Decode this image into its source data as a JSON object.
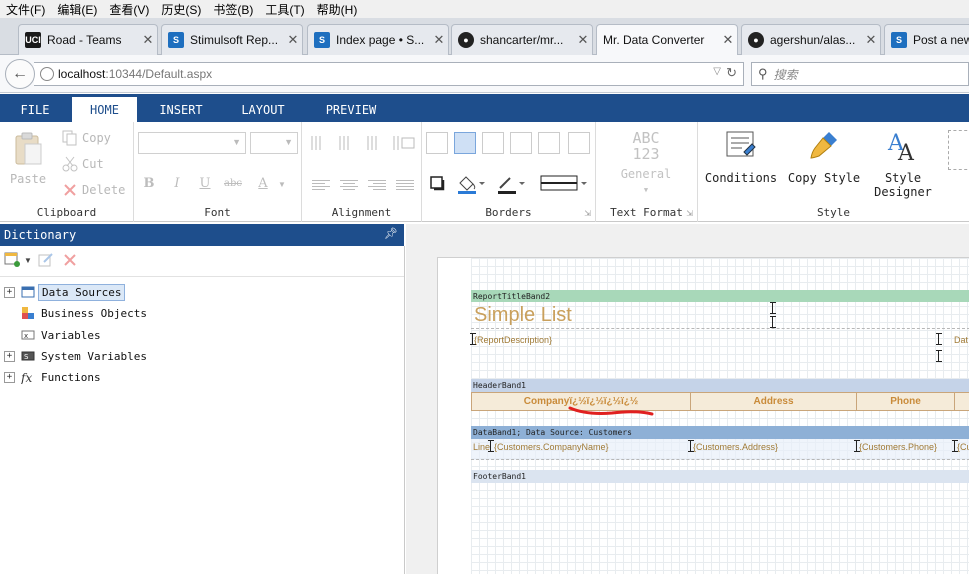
{
  "browser": {
    "menu": [
      "文件(F)",
      "编辑(E)",
      "查看(V)",
      "历史(S)",
      "书签(B)",
      "工具(T)",
      "帮助(H)"
    ],
    "tabs": [
      {
        "label": "Road - Teams",
        "icon": "teams-favicon",
        "color": "#1a1a1a",
        "glyph": "UCI"
      },
      {
        "label": "Stimulsoft Rep...",
        "icon": "stimulsoft-favicon",
        "color": "#1e6fbf",
        "glyph": "S"
      },
      {
        "label": "Index page • S...",
        "icon": "stimulsoft-favicon",
        "color": "#1e6fbf",
        "glyph": "S"
      },
      {
        "label": "shancarter/mr...",
        "icon": "github-favicon",
        "color": "#222222",
        "glyph": "●"
      },
      {
        "label": "Mr. Data Converter",
        "icon": "page-favicon",
        "color": "#ffffff",
        "glyph": ""
      },
      {
        "label": "agershun/alas...",
        "icon": "github-favicon",
        "color": "#222222",
        "glyph": "●"
      },
      {
        "label": "Post a new",
        "icon": "stimulsoft-favicon",
        "color": "#1e6fbf",
        "glyph": "S"
      }
    ],
    "url_host": "localhost",
    "url_path": ":10344/Default.aspx",
    "search_placeholder": "搜索"
  },
  "ribbon": {
    "tabs": [
      "FILE",
      "HOME",
      "INSERT",
      "LAYOUT",
      "PREVIEW"
    ],
    "active_tab": "HOME",
    "clipboard": {
      "title": "Clipboard",
      "paste": "Paste",
      "copy": "Copy",
      "cut": "Cut",
      "delete": "Delete"
    },
    "font": {
      "title": "Font",
      "bold": "B",
      "italic": "I",
      "underline": "U",
      "strike": "abc",
      "color": "A"
    },
    "alignment": {
      "title": "Alignment"
    },
    "borders": {
      "title": "Borders"
    },
    "text_format": {
      "title": "Text Format",
      "abc": "ABC",
      "num": "123",
      "general": "General"
    },
    "style": {
      "title": "Style",
      "conditions": "Conditions",
      "copy_style": "Copy Style",
      "style_designer_1": "Style",
      "style_designer_2": "Designer"
    }
  },
  "dictionary": {
    "title": "Dictionary",
    "items": [
      {
        "label": "Data Sources",
        "expandable": true,
        "selected": true
      },
      {
        "label": "Business Objects",
        "expandable": false,
        "selected": false
      },
      {
        "label": "Variables",
        "expandable": false,
        "selected": false
      },
      {
        "label": "System Variables",
        "expandable": true,
        "selected": false
      },
      {
        "label": "Functions",
        "expandable": true,
        "selected": false
      }
    ]
  },
  "report": {
    "title_band": "ReportTitleBand2",
    "title_text": "Simple List",
    "description": "{ReportDescription}",
    "date_partial": "Dat",
    "header_band": "HeaderBand1",
    "header_cells": [
      "Companyï¿½ï¿½ï¿½ï¿½",
      "Address",
      "Phone"
    ],
    "data_band": "DataBand1; Data Source: Customers",
    "data_cells": [
      "Line",
      "{Customers.CompanyName}",
      "{Customers.Address}",
      "{Customers.Phone}",
      "{Cu"
    ],
    "footer_band": "FooterBand1",
    "colors": {
      "title_band": "#a8d8b9",
      "header_band": "#c5d3e8",
      "data_band": "#8eb0d6",
      "footer_band": "#dbe4f0",
      "accent": "#1e4e8c"
    }
  }
}
